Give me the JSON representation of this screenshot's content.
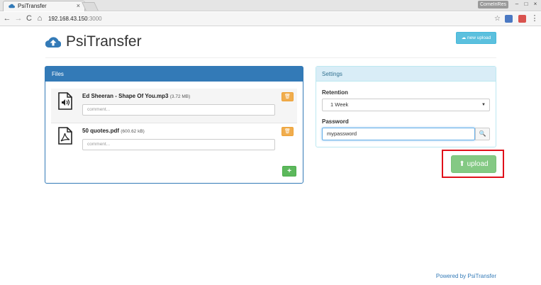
{
  "browser": {
    "tab_title": "PsiTransfer",
    "tab_close": "×",
    "profile_name": "ComeInRes",
    "window_controls": [
      "–",
      "□",
      "×"
    ],
    "url_host": "192.168.43.150",
    "url_port": ":3000",
    "nav": {
      "back": "←",
      "forward": "→",
      "reload": "C",
      "home": "⌂",
      "menu": "⋮",
      "star": "☆"
    }
  },
  "header": {
    "title": "PsiTransfer",
    "new_upload_label": "new upload"
  },
  "files_panel": {
    "title": "Files",
    "files": [
      {
        "name": "Ed Sheeran - Shape Of You.mp3",
        "size": "(3.72 MB)",
        "comment_placeholder": "comment...",
        "type": "audio-file-icon"
      },
      {
        "name": "50 quotes.pdf",
        "size": "(600.62 kB)",
        "comment_placeholder": "comment...",
        "type": "pdf-file-icon"
      }
    ],
    "delete_glyph": "🗑",
    "add_glyph": "+"
  },
  "settings_panel": {
    "title": "Settings",
    "retention_label": "Retention",
    "retention_value": "1 Week",
    "password_label": "Password",
    "password_value": "mypassword",
    "password_button_glyph": "🔍"
  },
  "upload": {
    "label": "upload",
    "glyph": "⬆"
  },
  "footer": {
    "text": "Powered by PsiTransfer"
  },
  "colors": {
    "primary": "#337ab7",
    "info": "#5bc0de",
    "success": "#5cb85c",
    "warning": "#f0ad4e",
    "highlight": "#e0101a"
  }
}
